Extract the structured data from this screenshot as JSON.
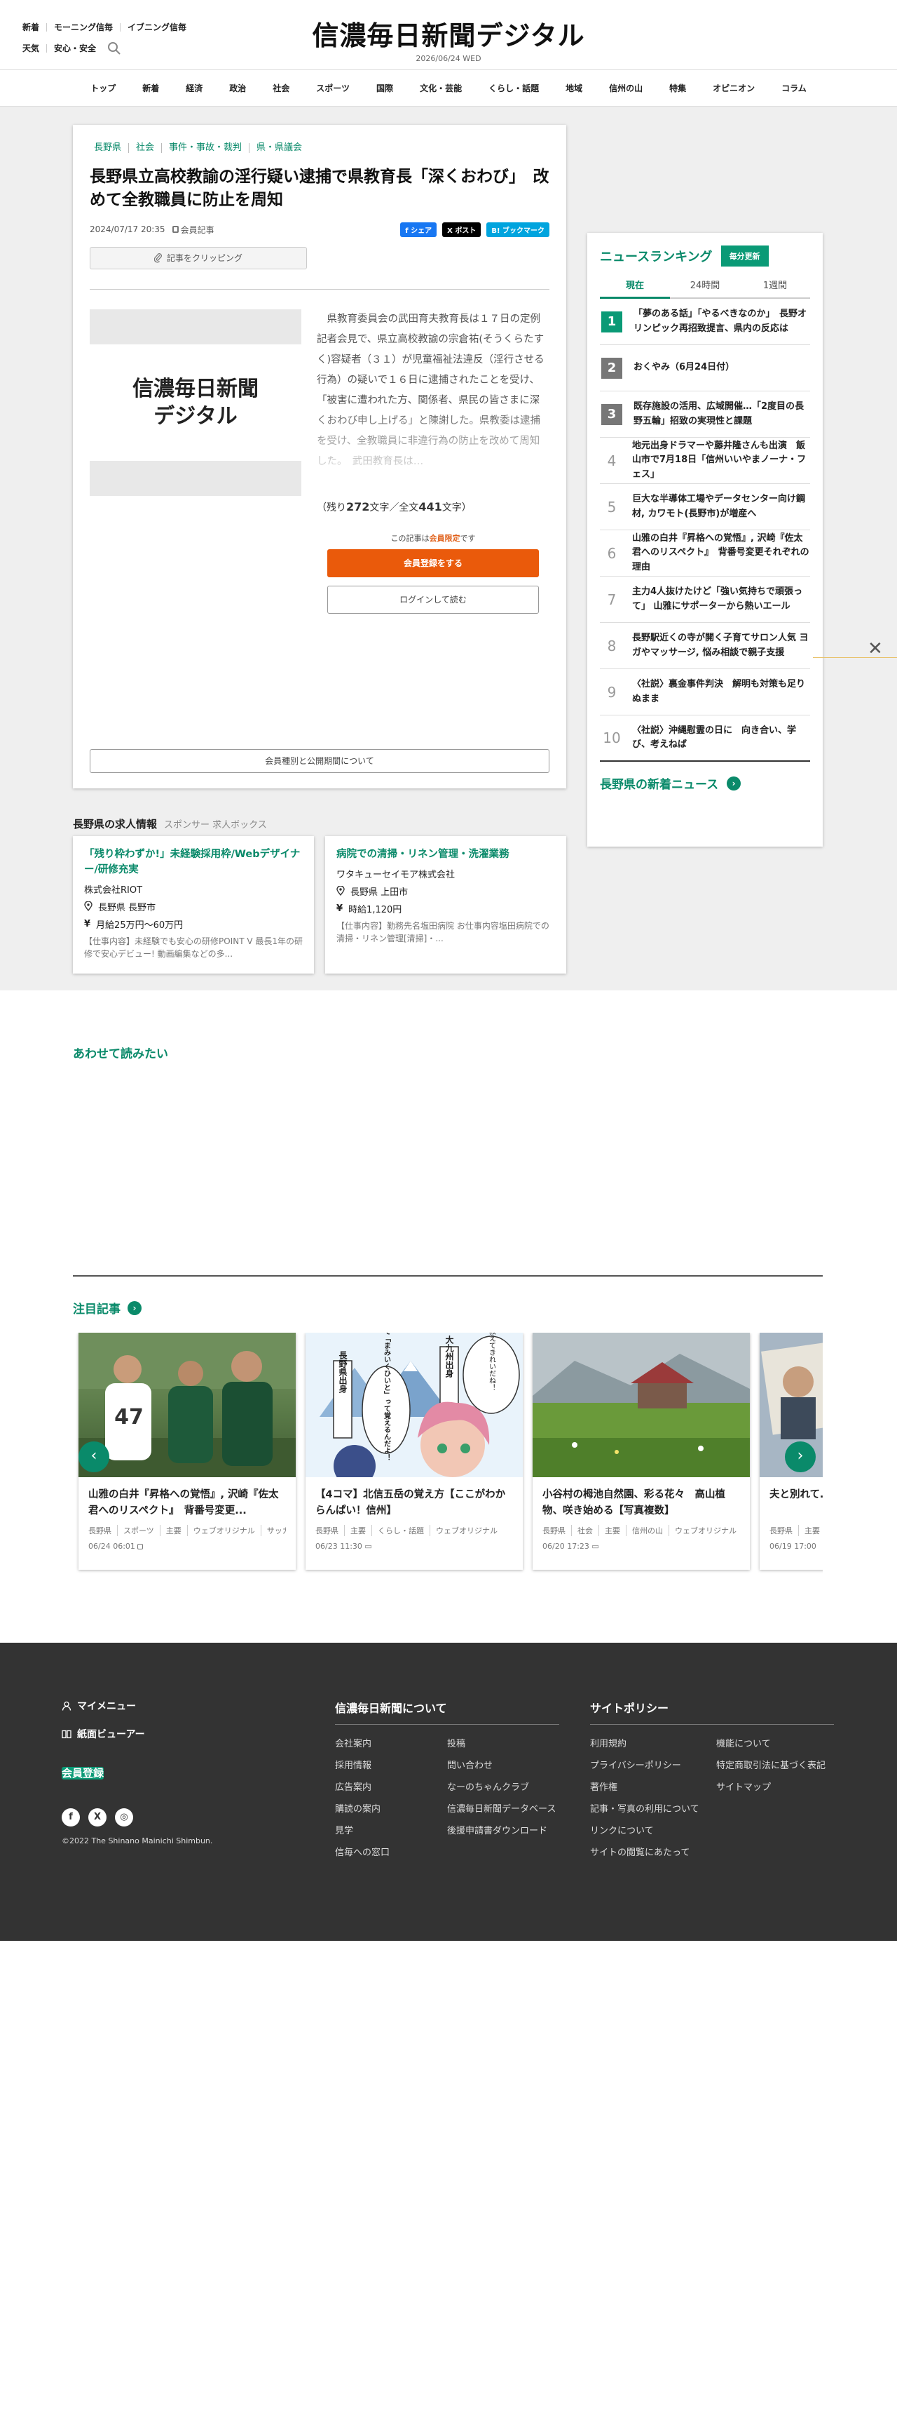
{
  "header": {
    "links_row1": [
      "新着",
      "モーニング信毎",
      "イブニング信毎"
    ],
    "links_row2": [
      "天気",
      "安心・安全"
    ],
    "logo": "信濃毎日新聞デジタル",
    "date": "2026/06/24 WED"
  },
  "nav": [
    "トップ",
    "新着",
    "経済",
    "政治",
    "社会",
    "スポーツ",
    "国際",
    "文化・芸能",
    "くらし・話題",
    "地域",
    "信州の山",
    "特集",
    "オピニオン",
    "コラム"
  ],
  "article": {
    "categories": [
      "長野県",
      "社会",
      "事件・事故・裁判",
      "県・県議会"
    ],
    "headline": "長野県立高校教諭の淫行疑い逮捕で県教育長「深くおわび」　改めて全教職員に防止を周知",
    "date": "2024/07/17 20:35",
    "member_label": "会員記事",
    "share": [
      "シェア",
      "ポスト",
      "ブックマーク"
    ],
    "clip_label": "記事をクリッピング",
    "image_logo_line1": "信濃毎日新聞",
    "image_logo_line2": "デジタル",
    "body": "　県教育委員会の武田育夫教育長は１７日の定例記者会見で、県立高校教諭の宗倉祐(そうくらたすく)容疑者（３１）が児童福祉法違反（淫行させる行為）の疑いで１６日に逮捕されたことを受け、「被害に遭われた方、関係者、県民の皆さまに深くおわび申し上げる」と陳謝した。県教委は逮捕を受け、全教職員に非違行為の防止を改めて周知した。　武田教育長は…",
    "remain_prefix": "（残り",
    "remain_count": "272",
    "remain_mid": "文字／全文",
    "total_count": "441",
    "remain_suffix": "文字）",
    "member_note_pre": "この記事は",
    "member_note_link": "会員限定",
    "member_note_post": "です",
    "register_label": "会員登録をする",
    "login_label": "ログインして読む",
    "plans_label": "会員種別と公開期間について"
  },
  "jobs": {
    "title": "長野県の求人情報",
    "sponsor": "スポンサー 求人ボックス",
    "items": [
      {
        "title": "「残り枠わずか!」未経験採用枠/Webデザイナー/研修充実",
        "company": "株式会社RIOT",
        "location": "長野県 長野市",
        "salary": "月給25万円～60万円",
        "desc": "【仕事内容】未経験でも安心の研修POINT V 最長1年の研修で安心デビュー! 動画編集などの多..."
      },
      {
        "title": "病院での清掃・リネン管理・洗濯業務",
        "company": "ワタキューセイモア株式会社",
        "location": "長野県 上田市",
        "salary": "時給1,120円",
        "desc": "【仕事内容】勤務先名塩田病院 お仕事内容塩田病院での清掃・リネン管理[清掃]・..."
      }
    ]
  },
  "ranking": {
    "title": "ニュースランキング",
    "badge": "毎分更新",
    "tabs": [
      "現在",
      "24時間",
      "1週間"
    ],
    "items": [
      {
        "rank": "1",
        "text": "「夢のある話」「やるべきなのか」　長野オリンピック再招致提言、県内の反応は"
      },
      {
        "rank": "2",
        "text": "おくやみ（6月24日付）"
      },
      {
        "rank": "3",
        "text": "既存施設の活用、広域開催…「2度目の長野五輪」招致の実現性と課題"
      },
      {
        "rank": "4",
        "text": "地元出身ドラマーや藤井隆さんも出演　飯山市で7月18日「信州いいやまノーナ・フェス」"
      },
      {
        "rank": "5",
        "text": "巨大な半導体工場やデータセンター向け鋼材, カワモト(長野市)が増産へ"
      },
      {
        "rank": "6",
        "text": "山雅の白井『昇格への覚悟』, 沢崎『佐太君へのリスペクト』　背番号変更それぞれの理由"
      },
      {
        "rank": "7",
        "text": "主力4人抜けたけど「強い気持ちで頑張って」 山雅にサポーターから熱いエール"
      },
      {
        "rank": "8",
        "text": "長野駅近くの寺が開く子育てサロン人気 ヨガやマッサージ, 悩み相談で親子支援"
      },
      {
        "rank": "9",
        "text": "〈社説〉裏金事件判決　解明も対策も足りぬまま"
      },
      {
        "rank": "10",
        "text": "〈社説〉沖縄慰霊の日に　向き合い、学び、考えねば"
      }
    ],
    "more_label": "長野県の新着ニュース"
  },
  "related": {
    "title": "あわせて読みたい"
  },
  "featured": {
    "title": "注目記事",
    "cards": [
      {
        "title": "山雅の白井『昇格への覚悟』, 沢崎『佐太君へのリスペクト』　背番号変更...",
        "tags": [
          "長野県",
          "スポーツ",
          "主要",
          "ウェブオリジナル",
          "サッカー"
        ],
        "date": "06/24 06:01"
      },
      {
        "title": "【4コマ】北信五岳の覚え方【ここがわからんぱい！信州】",
        "tags": [
          "長野県",
          "主要",
          "くらし・話題",
          "ウェブオリジナル"
        ],
        "date": "06/23 11:30"
      },
      {
        "title": "小谷村の栂池自然園、彩る花々　高山植物、咲き始める【写真複数】",
        "tags": [
          "長野県",
          "社会",
          "主要",
          "信州の山",
          "ウェブオリジナル"
        ],
        "date": "06/20 17:23"
      },
      {
        "title": "夫と別れて…は　交錯し...",
        "tags": [
          "長野県",
          "主要"
        ],
        "date": "06/19 17:00"
      }
    ],
    "manga_text_1": "長野県出身",
    "manga_text_2": "大九州出身",
    "manga_text_3": "北信五岳教えてきれいだね！",
    "manga_text_4": "頭文字をとって「まみいくひいと」って覚えるんだよ！"
  },
  "footer": {
    "mymenu": "マイメニュー",
    "viewer": "紙面ビューアー",
    "register": "会員登録",
    "copyright": "©2022 The Shinano Mainichi Shimbun.",
    "about_title": "信濃毎日新聞について",
    "about_links": [
      "会社案内",
      "投稿",
      "採用情報",
      "問い合わせ",
      "広告案内",
      "なーのちゃんクラブ",
      "購読の案内",
      "信濃毎日新聞データベース",
      "見学",
      "後援申請書ダウンロード",
      "信毎への窓口"
    ],
    "policy_title": "サイトポリシー",
    "policy_links": [
      "利用規約",
      "機能について",
      "プライバシーポリシー",
      "特定商取引法に基づく表記",
      "著作権",
      "サイトマップ",
      "記事・写真の利用について",
      "",
      "リンクについて",
      "",
      "サイトの閲覧にあたって"
    ]
  }
}
